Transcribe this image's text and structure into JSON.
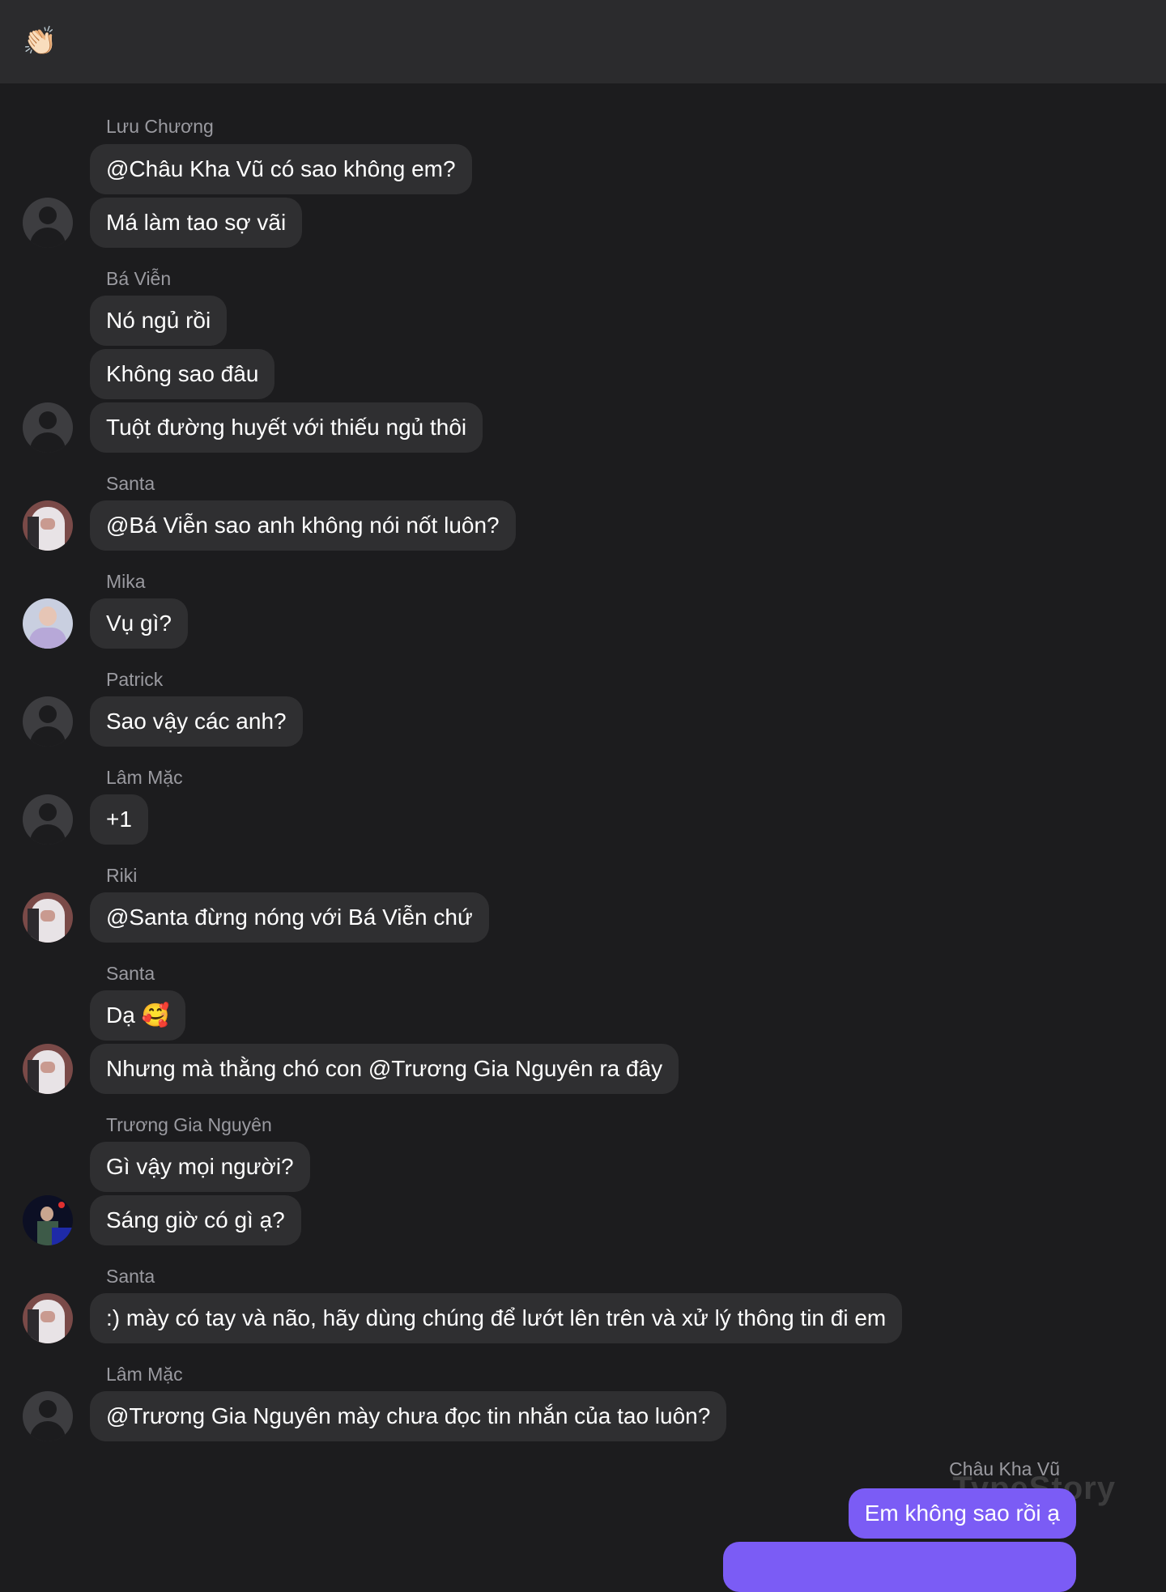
{
  "header": {
    "icon": "clapping-hands-emoji",
    "icon_glyph": "👏🏻"
  },
  "messages": [
    {
      "sender": "Lưu Chương",
      "texts": [
        "@Châu Kha Vũ có sao không em?",
        "Má làm tao sợ vãi"
      ]
    },
    {
      "sender": "Bá Viễn",
      "texts": [
        "Nó ngủ rồi",
        "Không sao đâu",
        "Tuột đường huyết với thiếu ngủ thôi"
      ]
    },
    {
      "sender": "Santa",
      "texts": [
        "@Bá Viễn sao anh không nói nốt luôn?"
      ]
    },
    {
      "sender": "Mika",
      "texts": [
        "Vụ gì?"
      ]
    },
    {
      "sender": "Patrick",
      "texts": [
        "Sao vậy các anh?"
      ]
    },
    {
      "sender": "Lâm Mặc",
      "texts": [
        "+1"
      ]
    },
    {
      "sender": "Riki",
      "texts": [
        "@Santa đừng nóng với Bá Viễn chứ"
      ]
    },
    {
      "sender": "Santa",
      "texts": [
        "Dạ 🥰",
        "Nhưng mà thằng chó con @Trương Gia Nguyên ra đây"
      ]
    },
    {
      "sender": "Trương Gia Nguyên",
      "texts": [
        "Gì vậy mọi người?",
        "Sáng giờ có gì ạ?"
      ]
    },
    {
      "sender": "Santa",
      "texts": [
        ":) mày có tay và não, hãy dùng chúng để lướt lên trên và xử lý thông tin đi em"
      ]
    },
    {
      "sender": "Lâm Mặc",
      "texts": [
        "@Trương Gia Nguyên mày chưa đọc tin nhắn của tao luôn?"
      ]
    }
  ],
  "self": {
    "sender": "Châu Kha Vũ",
    "texts": [
      "Em không sao rồi ạ"
    ]
  },
  "watermark": "TypeStory",
  "colors": {
    "background": "#1c1c1e",
    "bubble": "#2f2f31",
    "self_bubble": "#7b5cf5",
    "header": "#2b2b2d"
  }
}
